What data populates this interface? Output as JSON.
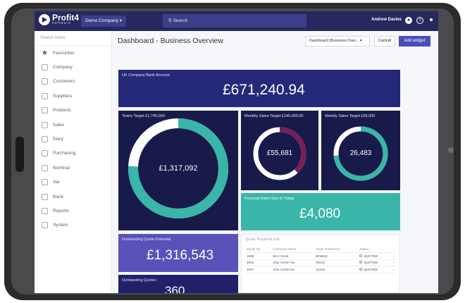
{
  "app": {
    "logo": "Profit4",
    "logo_sub": "software",
    "company": "Demo Company ▾",
    "search_placeholder": "Search",
    "user": "Andrew Davies"
  },
  "icons": [
    "logo-icon",
    "circle-icon",
    "help-icon",
    "user-icon",
    "star-icon"
  ],
  "sidebar": {
    "search_placeholder": "Search menu",
    "items": [
      {
        "label": "Favourites",
        "icon": "star-icon"
      },
      {
        "label": "Company",
        "icon": "company-icon"
      },
      {
        "label": "Customers",
        "icon": "customers-icon"
      },
      {
        "label": "Suppliers",
        "icon": "suppliers-icon"
      },
      {
        "label": "Products",
        "icon": "products-icon"
      },
      {
        "label": "Sales",
        "icon": "sales-icon"
      },
      {
        "label": "Diary",
        "icon": "diary-icon"
      },
      {
        "label": "Purchasing",
        "icon": "purchasing-icon"
      },
      {
        "label": "Nominal",
        "icon": "nominal-icon"
      },
      {
        "label": "Vat",
        "icon": "vat-icon"
      },
      {
        "label": "Bank",
        "icon": "bank-icon"
      },
      {
        "label": "Reports",
        "icon": "reports-icon"
      },
      {
        "label": "System",
        "icon": "system-icon"
      }
    ]
  },
  "main": {
    "title": "Dashboard - Business Overview",
    "dashboard_select": "Dashboard (Business Over... ▾",
    "cancel_label": "Cancel",
    "add_widget_label": "Add widget"
  },
  "tiles": {
    "bank": {
      "label": "UK Company Bank Account",
      "value": "£671,240.94"
    },
    "yearly": {
      "label": "Yearly Target £1,740,000",
      "value": "£1,317,092",
      "progress": 0.757
    },
    "monthly": {
      "label": "Monthly Sales Target £145,000.00",
      "value": "£55,681",
      "progress": 0.38
    },
    "weekly": {
      "label": "Weekly Sales Target £36,000",
      "value": "26,483",
      "progress": 0.736
    },
    "forecast": {
      "label": "Forecast Sales Due In Today",
      "value": "£4,080"
    },
    "quote_potential": {
      "label": "Outstanding Quote Potential",
      "value": "£1,316,543"
    },
    "outstanding_quotes": {
      "label": "Outstanding Quotes",
      "value": "360"
    }
  },
  "quote_progress": {
    "title": "Quote Progress List",
    "columns": [
      "Quote No",
      "Customer Name",
      "Order Reference",
      "Status",
      ""
    ],
    "rows": [
      [
        "1008",
        "Sim Circuit",
        "BC8832",
        "QUOTED",
        "›"
      ],
      [
        "1004",
        "Alan Archer Ne",
        "00212",
        "QUOTED",
        "›"
      ],
      [
        "1007",
        "Alan Archer Ne",
        "21243",
        "QUOTED",
        "›"
      ]
    ]
  },
  "colors": {
    "topbar": "#27285e",
    "tile_dark": "#181a4a",
    "teal": "#39b5aa",
    "purple": "#5a52b8",
    "accent": "#4a4cb8",
    "magenta": "#7a1e5a"
  }
}
